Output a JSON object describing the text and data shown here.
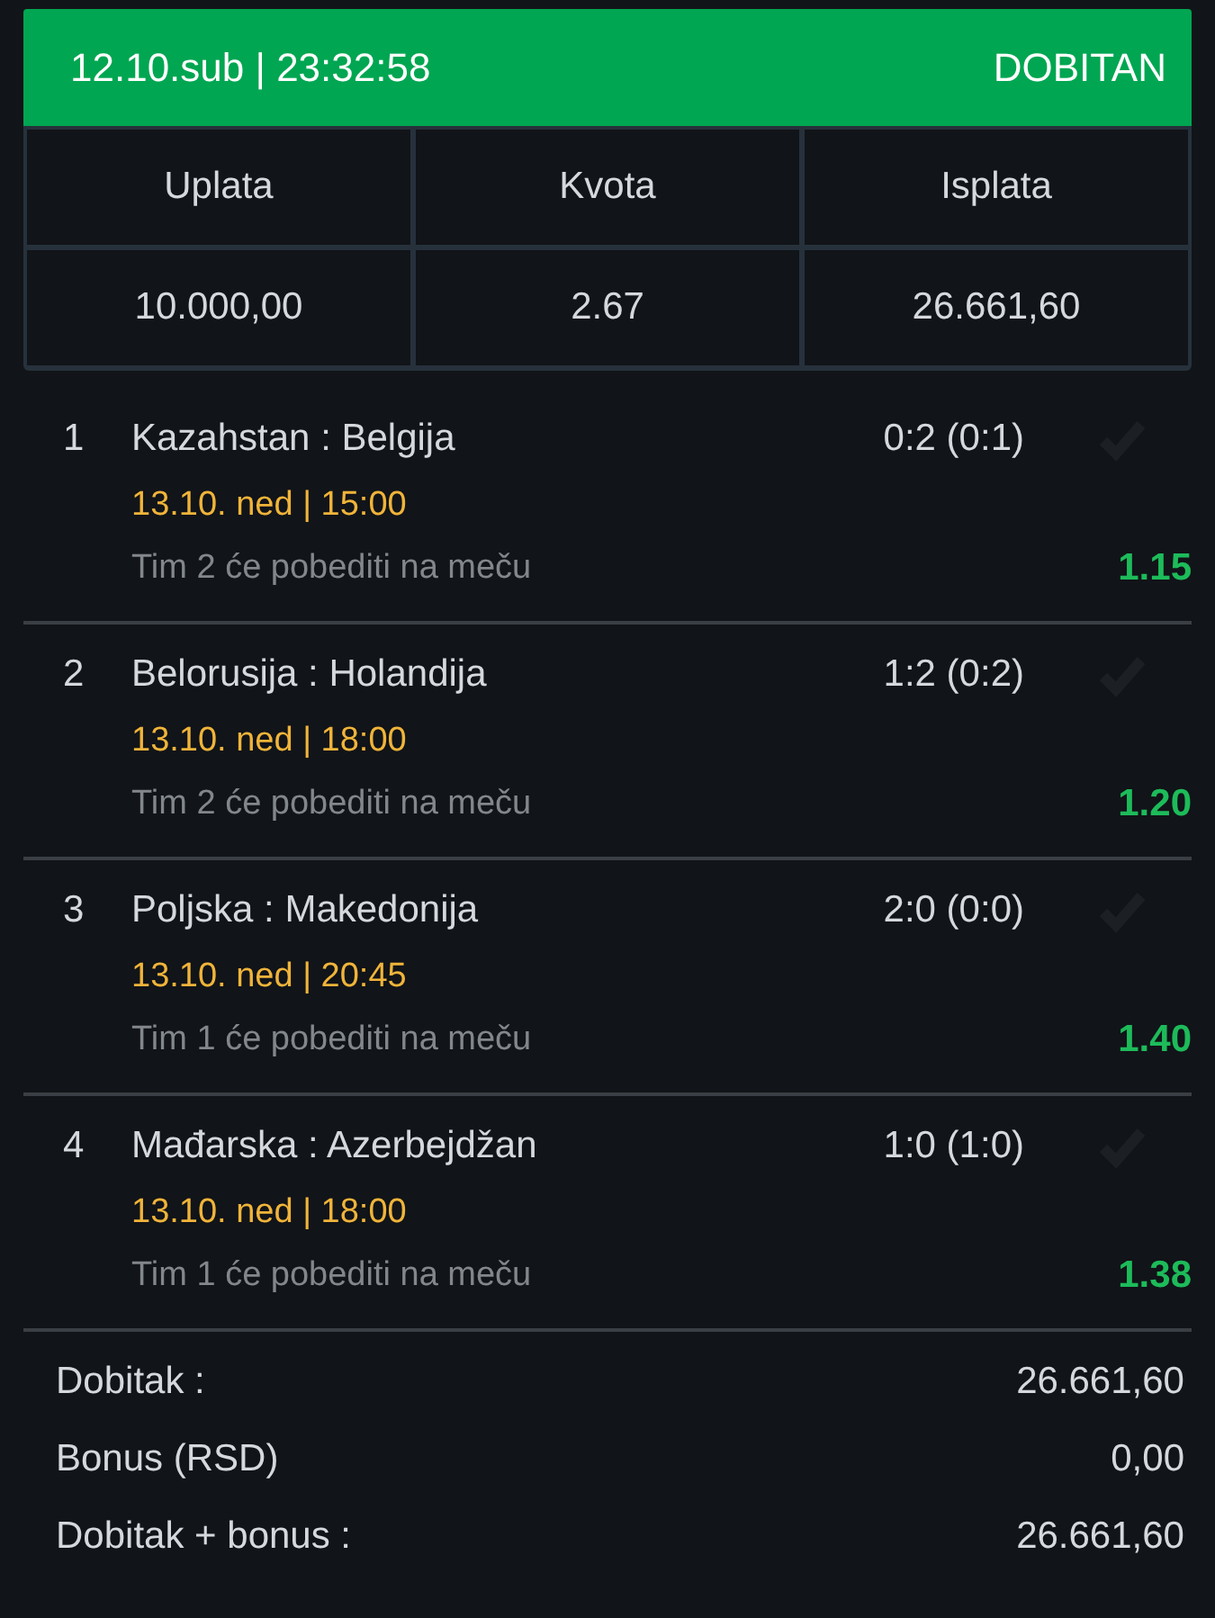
{
  "header": {
    "datetime": "12.10.sub | 23:32:58",
    "status": "DOBITAN"
  },
  "stakes": {
    "columns": [
      "Uplata",
      "Kvota",
      "Isplata"
    ],
    "values": [
      "10.000,00",
      "2.67",
      "26.661,60"
    ]
  },
  "matches": [
    {
      "number": "1",
      "teams": "Kazahstan : Belgija",
      "score": "0:2 (0:1)",
      "start": "13.10. ned | 15:00",
      "tip": "Tim 2 će pobediti na meču",
      "odds": "1.15"
    },
    {
      "number": "2",
      "teams": "Belorusija : Holandija",
      "score": "1:2 (0:2)",
      "start": "13.10. ned | 18:00",
      "tip": "Tim 2 će pobediti na meču",
      "odds": "1.20"
    },
    {
      "number": "3",
      "teams": "Poljska : Makedonija",
      "score": "2:0 (0:0)",
      "start": "13.10. ned | 20:45",
      "tip": "Tim 1 će pobediti na meču",
      "odds": "1.40"
    },
    {
      "number": "4",
      "teams": "Mađarska : Azerbejdžan",
      "score": "1:0 (1:0)",
      "start": "13.10. ned | 18:00",
      "tip": "Tim 1 će pobediti na meču",
      "odds": "1.38"
    }
  ],
  "summary": [
    {
      "label": "Dobitak :",
      "value": "26.661,60"
    },
    {
      "label": "Bonus (RSD)",
      "value": "0,00"
    },
    {
      "label": "Dobitak + bonus :",
      "value": "26.661,60"
    }
  ]
}
